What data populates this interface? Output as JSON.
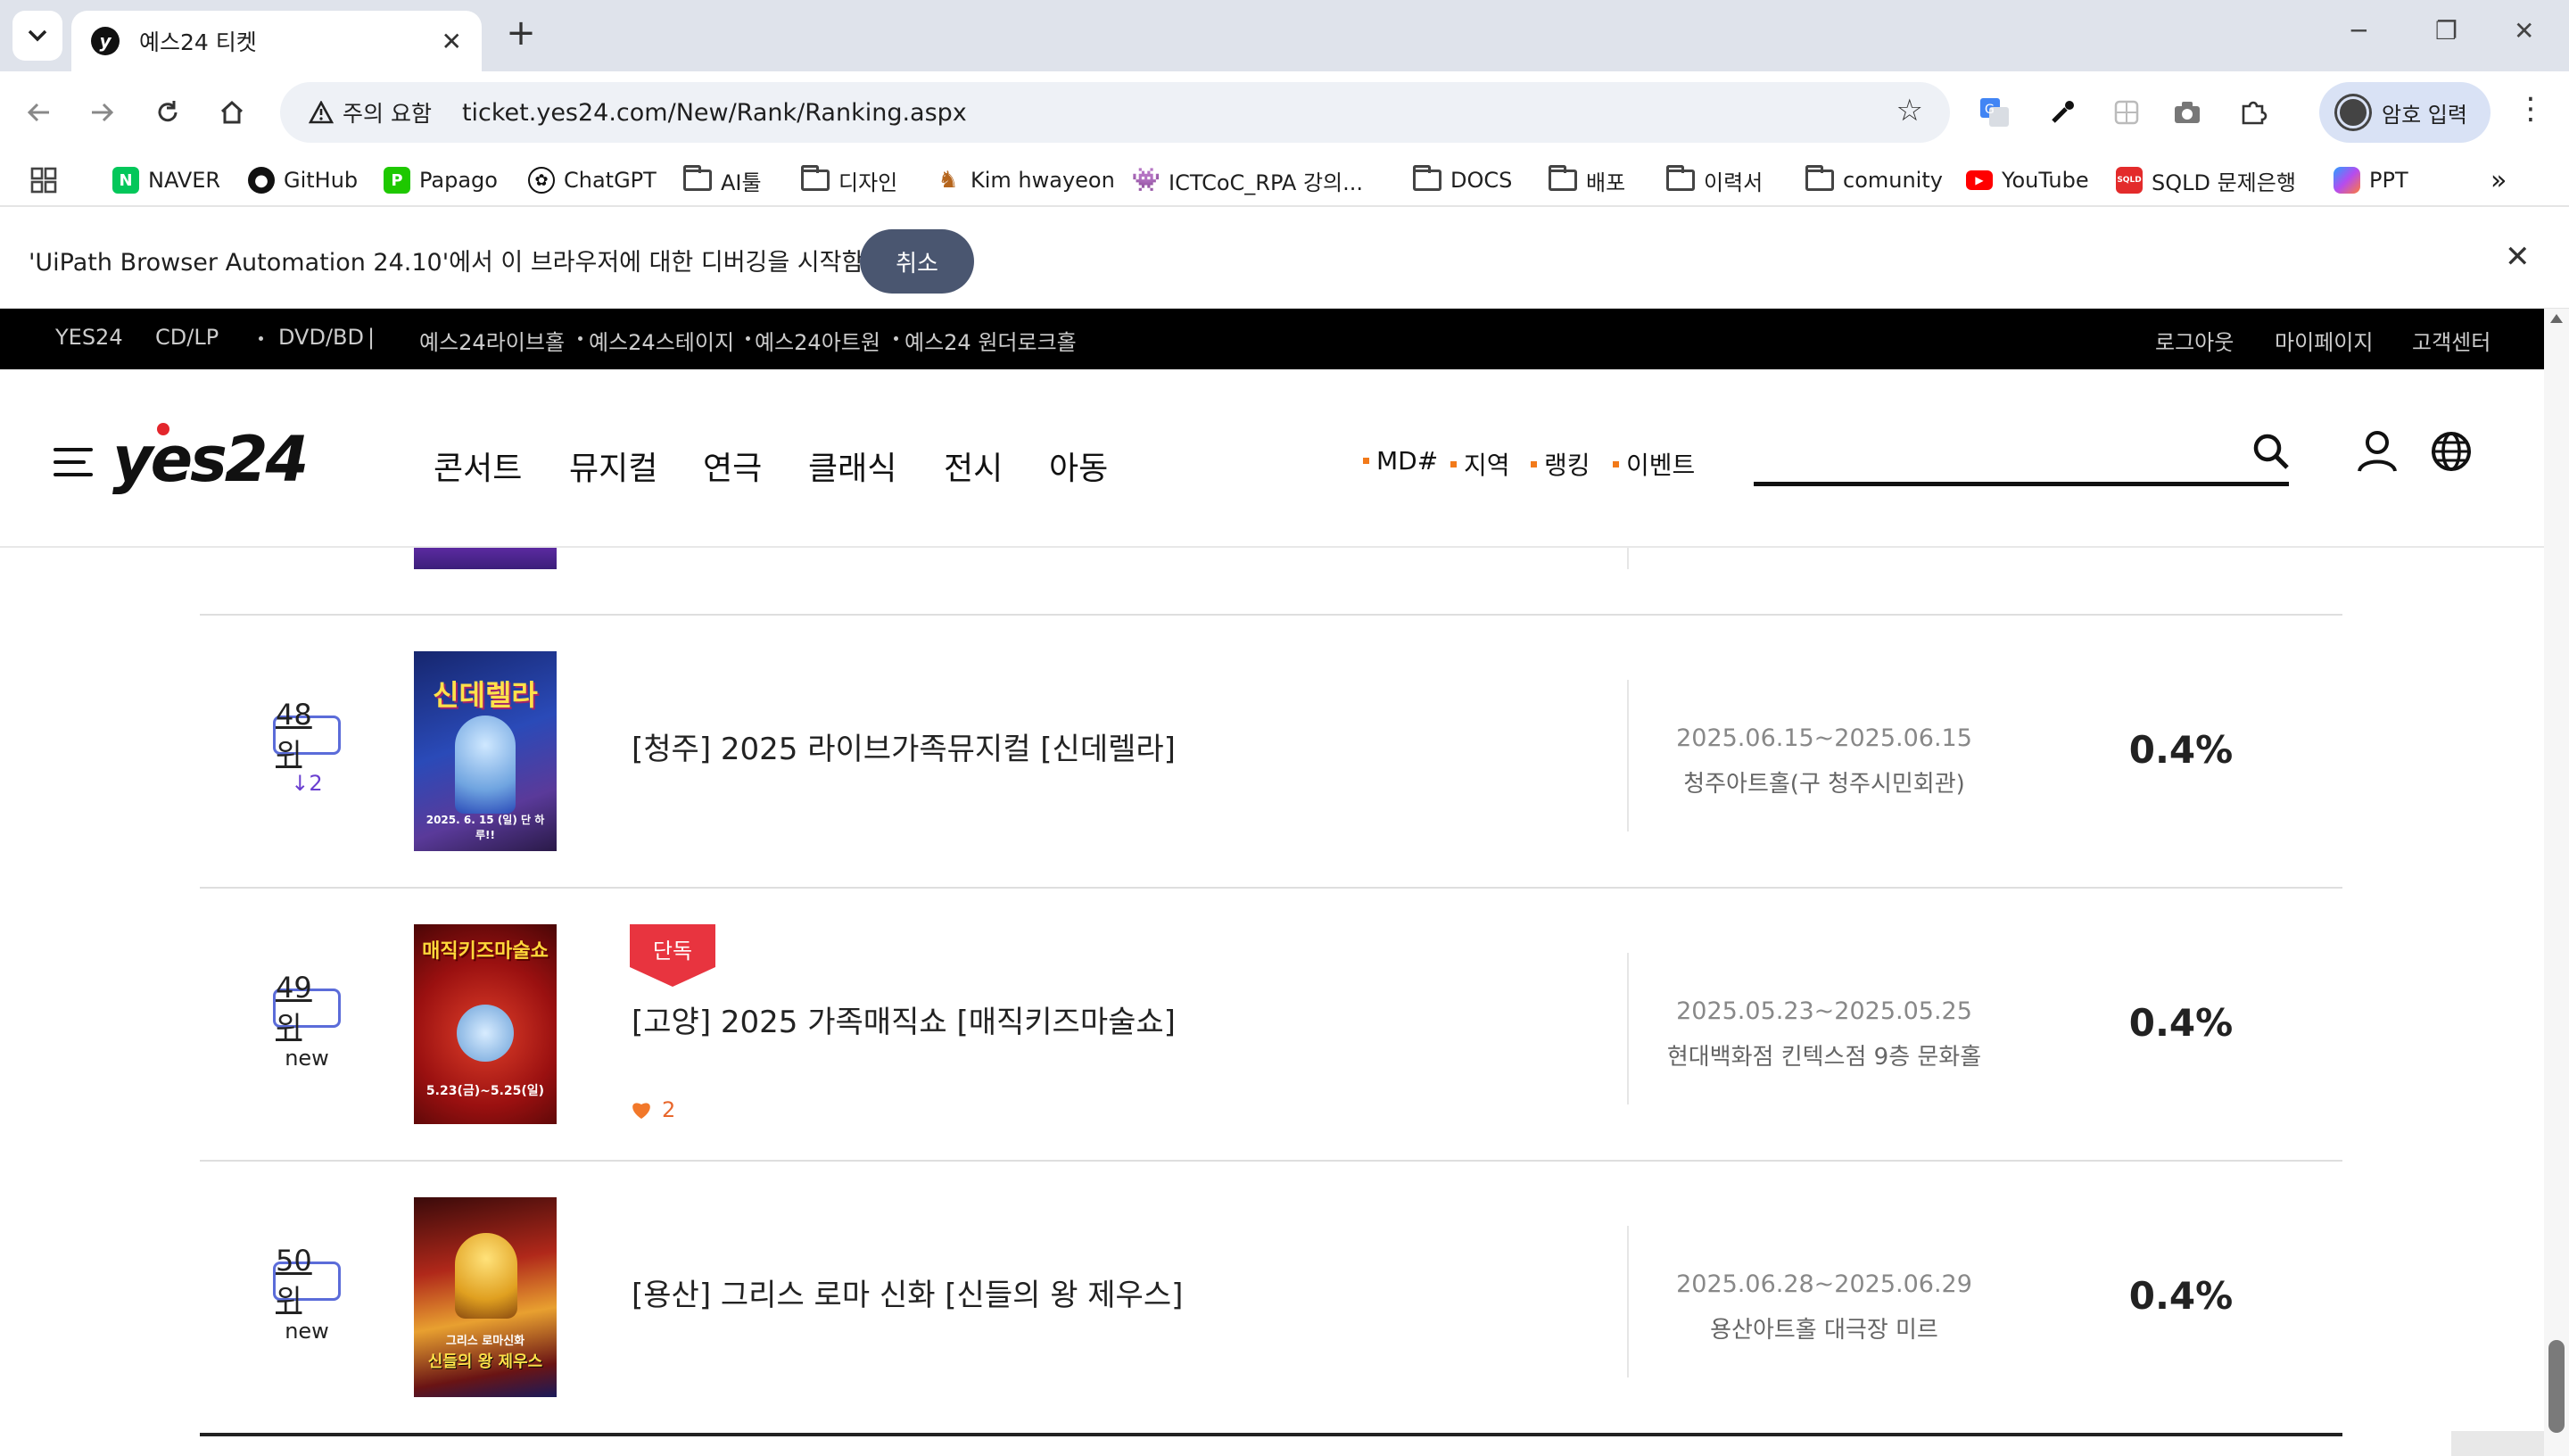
{
  "browser": {
    "tab_title": "예스24 티켓",
    "security_chip": "주의 요함",
    "url": "ticket.yes24.com/New/Rank/Ranking.aspx",
    "profile_label": "암호 입력",
    "bookmarks": [
      {
        "label": "NAVER",
        "icon": "naver-icon"
      },
      {
        "label": "GitHub",
        "icon": "github-icon"
      },
      {
        "label": "Papago",
        "icon": "papago-icon"
      },
      {
        "label": "ChatGPT",
        "icon": "chatgpt-icon"
      },
      {
        "label": "AI툴",
        "icon": "folder-icon"
      },
      {
        "label": "디자인",
        "icon": "folder-icon"
      },
      {
        "label": "Kim hwayeon",
        "icon": "horse-icon"
      },
      {
        "label": "ICTCoC_RPA 강의...",
        "icon": "alien-icon"
      },
      {
        "label": "DOCS",
        "icon": "folder-icon"
      },
      {
        "label": "배포",
        "icon": "folder-icon"
      },
      {
        "label": "이력서",
        "icon": "folder-icon"
      },
      {
        "label": "comunity",
        "icon": "folder-icon"
      },
      {
        "label": "YouTube",
        "icon": "youtube-icon"
      },
      {
        "label": "SQLD 문제은행",
        "icon": "sqld-icon"
      },
      {
        "label": "PPT",
        "icon": "copilot-icon"
      }
    ],
    "infobar": {
      "message": "'UiPath Browser Automation 24.10'에서 이 브라우저에 대한 디버깅을 시작함",
      "cancel": "취소"
    }
  },
  "site": {
    "topbar_left": [
      "YES24",
      "CD/LP",
      "DVD/BD"
    ],
    "topbar_venues": [
      "예스24라이브홀",
      "예스24스테이지",
      "예스24아트원",
      "예스24 원더로크홀"
    ],
    "topbar_right": [
      "로그아웃",
      "마이페이지",
      "고객센터"
    ],
    "logo": "yes24",
    "gnb": [
      "콘서트",
      "뮤지컬",
      "연극",
      "클래식",
      "전시",
      "아동"
    ],
    "subnav": [
      "MD#",
      "지역",
      "랭킹",
      "이벤트"
    ],
    "search_placeholder": ""
  },
  "ranking": [
    {
      "rank": "48위",
      "change": "↓2",
      "change_color": "#6a3fd0",
      "title": "[청주] 2025 라이브가족뮤지컬 [신데렐라]",
      "dates": "2025.06.15~2025.06.15",
      "venue": "청주아트홀(구 청주시민회관)",
      "share": "0.4%",
      "poster_text": "신데렐라",
      "poster_sub": "2025. 6. 15 (일) 단 하루!!",
      "exclusive": false,
      "likes": null
    },
    {
      "rank": "49위",
      "change": "new",
      "change_color": "#222222",
      "title": "[고양] 2025 가족매직쇼 [매직키즈마술쇼]",
      "dates": "2025.05.23~2025.05.25",
      "venue": "현대백화점 킨텍스점 9층 문화홀",
      "share": "0.4%",
      "poster_text": "매직키즈마술쇼",
      "poster_sub": "5.23(금)~5.25(일)",
      "exclusive": true,
      "exclusive_label": "단독",
      "likes": "2"
    },
    {
      "rank": "50위",
      "change": "new",
      "change_color": "#222222",
      "title": "[용산] 그리스 로마 신화 [신들의 왕 제우스]",
      "dates": "2025.06.28~2025.06.29",
      "venue": "용산아트홀 대극장 미르",
      "share": "0.4%",
      "poster_text": "신들의 왕 제우스",
      "poster_sub": "그리스 로마신화",
      "exclusive": false,
      "likes": null
    }
  ],
  "colors": {
    "accent_orange": "#f27a1a",
    "exclusive_red": "#e8343f",
    "rank_border": "#5b6cd9",
    "infobar_button": "#4a5670"
  }
}
